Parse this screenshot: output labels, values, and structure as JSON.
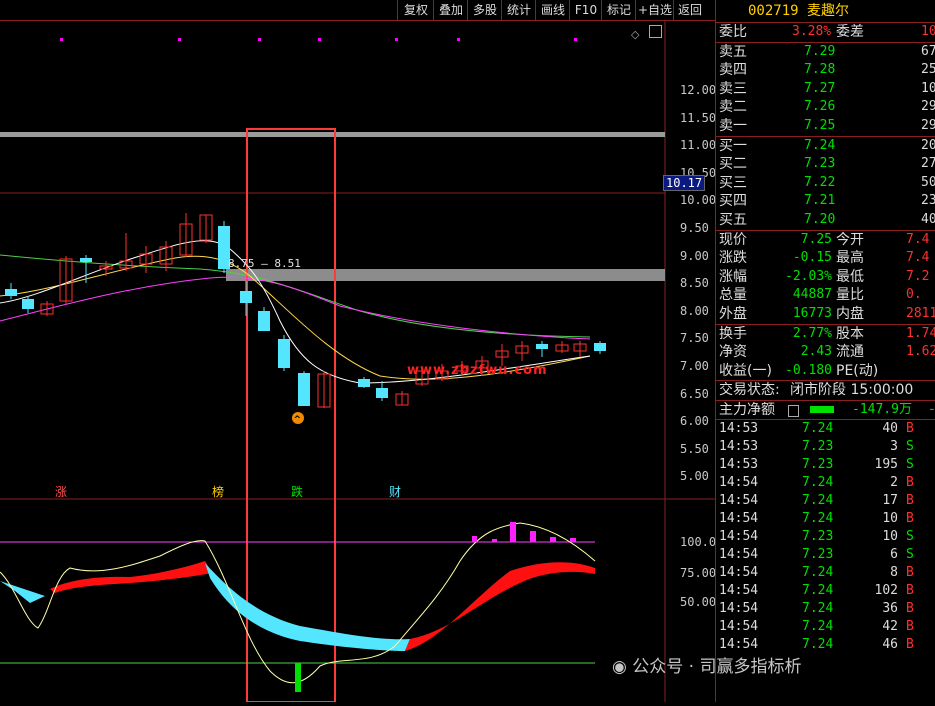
{
  "toolbar": {
    "buttons": [
      "复权",
      "叠加",
      "多股",
      "统计",
      "画线",
      "F10",
      "标记",
      "+自选",
      "返回"
    ]
  },
  "chart": {
    "price_axis": [
      "12.00",
      "11.50",
      "11.00",
      "10.50",
      "10.00",
      "9.50",
      "9.00",
      "8.50",
      "8.00",
      "7.50",
      "7.00",
      "6.50",
      "6.00",
      "5.50",
      "5.00"
    ],
    "current_price_tag": "10.17",
    "annotation_high": "8.75",
    "annotation_low": "8.51",
    "event_markers": [
      "涨",
      "榜",
      "跌",
      "财"
    ],
    "url_watermark": "www.zbzfwu.com",
    "indicator_axis": [
      "100.0",
      "75.00",
      "50.00"
    ]
  },
  "quote": {
    "code": "002719",
    "name": "麦趣尔",
    "weibi_label": "委比",
    "weibi_value": "3.28%",
    "weicha_label": "委差",
    "weicha_value": "10",
    "asks": [
      {
        "label": "卖五",
        "price": "7.29",
        "vol": "67"
      },
      {
        "label": "卖四",
        "price": "7.28",
        "vol": "25"
      },
      {
        "label": "卖三",
        "price": "7.27",
        "vol": "10"
      },
      {
        "label": "卖二",
        "price": "7.26",
        "vol": "29"
      },
      {
        "label": "卖一",
        "price": "7.25",
        "vol": "29"
      }
    ],
    "bids": [
      {
        "label": "买一",
        "price": "7.24",
        "vol": "20"
      },
      {
        "label": "买二",
        "price": "7.23",
        "vol": "27"
      },
      {
        "label": "买三",
        "price": "7.22",
        "vol": "50"
      },
      {
        "label": "买四",
        "price": "7.21",
        "vol": "23"
      },
      {
        "label": "买五",
        "price": "7.20",
        "vol": "40"
      }
    ],
    "stats": [
      {
        "l1": "现价",
        "v1": "7.25",
        "l2": "今开",
        "v2": "7.4"
      },
      {
        "l1": "涨跌",
        "v1": "-0.15",
        "l2": "最高",
        "v2": "7.4"
      },
      {
        "l1": "涨幅",
        "v1": "-2.03%",
        "l2": "最低",
        "v2": "7.2"
      },
      {
        "l1": "总量",
        "v1": "44887",
        "l2": "量比",
        "v2": "0."
      },
      {
        "l1": "外盘",
        "v1": "16773",
        "l2": "内盘",
        "v2": "2811"
      }
    ],
    "stats2": [
      {
        "l1": "换手",
        "v1": "2.77%",
        "l2": "股本",
        "v2": "1.74"
      },
      {
        "l1": "净资",
        "v1": "2.43",
        "l2": "流通",
        "v2": "1.62"
      },
      {
        "l1": "收益(一)",
        "v1": "-0.180",
        "l2": "PE(动)",
        "v2": ""
      }
    ],
    "status_label": "交易状态:",
    "status_value": "闭市阶段 15:00:00",
    "mainflow_label": "主力净额",
    "mainflow_value": "-147.9万",
    "mainflow_extra": "-4"
  },
  "ticks": [
    {
      "t": "14:53",
      "p": "7.24",
      "v": "40",
      "s": "B"
    },
    {
      "t": "14:53",
      "p": "7.23",
      "v": "3",
      "s": "S"
    },
    {
      "t": "14:53",
      "p": "7.23",
      "v": "195",
      "s": "S"
    },
    {
      "t": "14:54",
      "p": "7.24",
      "v": "2",
      "s": "B"
    },
    {
      "t": "14:54",
      "p": "7.24",
      "v": "17",
      "s": "B"
    },
    {
      "t": "14:54",
      "p": "7.24",
      "v": "10",
      "s": "B"
    },
    {
      "t": "14:54",
      "p": "7.23",
      "v": "10",
      "s": "S"
    },
    {
      "t": "14:54",
      "p": "7.23",
      "v": "6",
      "s": "S"
    },
    {
      "t": "14:54",
      "p": "7.24",
      "v": "8",
      "s": "B"
    },
    {
      "t": "14:54",
      "p": "7.24",
      "v": "102",
      "s": "B"
    },
    {
      "t": "14:54",
      "p": "7.24",
      "v": "36",
      "s": "B"
    },
    {
      "t": "14:54",
      "p": "7.24",
      "v": "42",
      "s": "B"
    },
    {
      "t": "14:54",
      "p": "7.24",
      "v": "46",
      "s": "B"
    }
  ],
  "watermark": "公众号 · 司赢多指标析",
  "colors": {
    "up": "#ff3030",
    "down": "#54e5ff",
    "grid": "#8a1f1f",
    "green": "#00e000"
  }
}
